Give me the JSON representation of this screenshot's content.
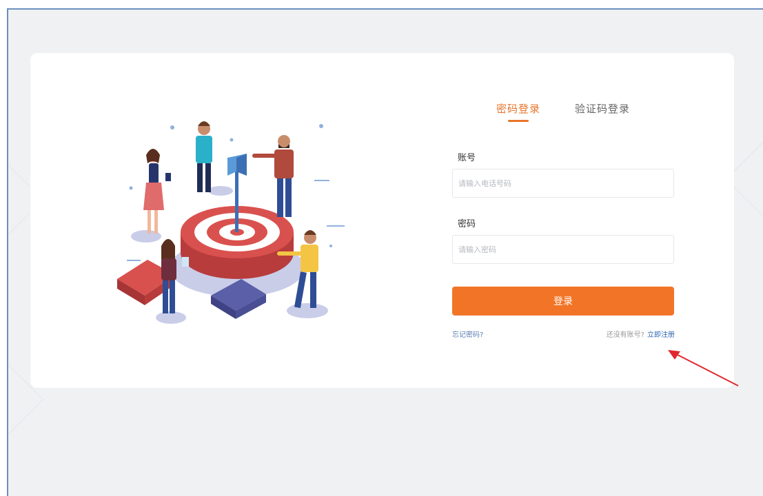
{
  "login": {
    "tabs": [
      {
        "label": "密码登录",
        "active": true
      },
      {
        "label": "验证码登录",
        "active": false
      }
    ],
    "account": {
      "label": "账号",
      "placeholder": "请输入电话号码",
      "value": ""
    },
    "password": {
      "label": "密码",
      "placeholder": "请输入密码",
      "value": ""
    },
    "submit_label": "登录",
    "forgot_label": "忘记密码?",
    "register_question": "还没有账号?",
    "register_link": "立即注册"
  },
  "colors": {
    "accent": "#f27527",
    "link": "#2f68b3",
    "annotation_arrow": "#e0282e"
  },
  "icons": [
    "target-illustration-icon",
    "annotation-arrow-icon"
  ]
}
